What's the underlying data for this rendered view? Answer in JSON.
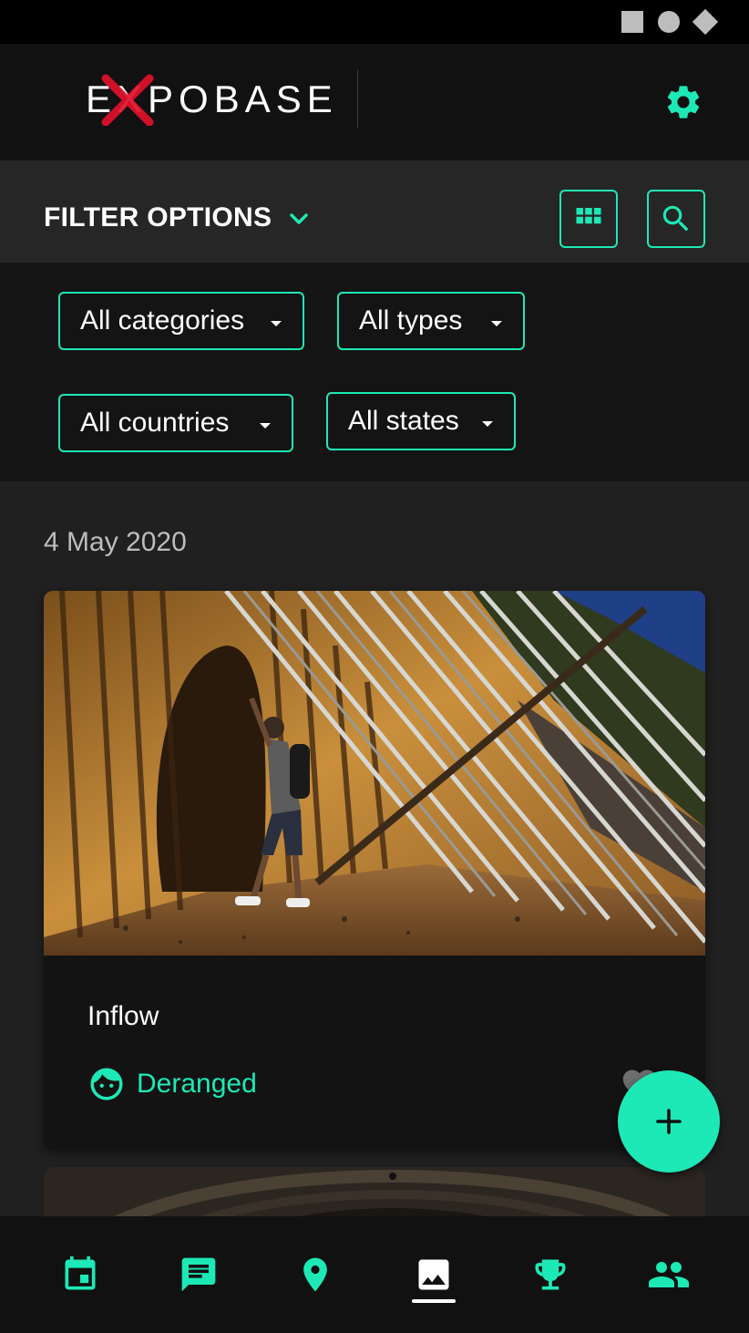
{
  "brand": {
    "logo_text": "EXPOBASE",
    "accent": "#1de9b6",
    "logo_x_color": "#e0112b"
  },
  "status_bar": {
    "icons": [
      "square-icon",
      "circle-icon",
      "diamond-icon"
    ]
  },
  "app_bar": {
    "settings_icon": "gear-icon"
  },
  "filter": {
    "title": "FILTER OPTIONS",
    "toggle_icon": "chevron-down-icon",
    "actions": [
      "grid-view-icon",
      "search-icon"
    ],
    "dropdowns": {
      "categories": "All categories",
      "types": "All types",
      "countries": "All countries",
      "states": "All states"
    }
  },
  "feed": {
    "date": "4 May 2020",
    "card": {
      "title": "Inflow",
      "author": "Deranged",
      "author_icon": "face-icon",
      "like_icon": "heart-icon"
    }
  },
  "fab": {
    "icon": "plus-icon"
  },
  "bottom_nav": {
    "items": [
      "calendar-icon",
      "chat-icon",
      "location-pin-icon",
      "photo-icon",
      "trophy-icon",
      "people-icon"
    ],
    "active": "photo-icon"
  }
}
